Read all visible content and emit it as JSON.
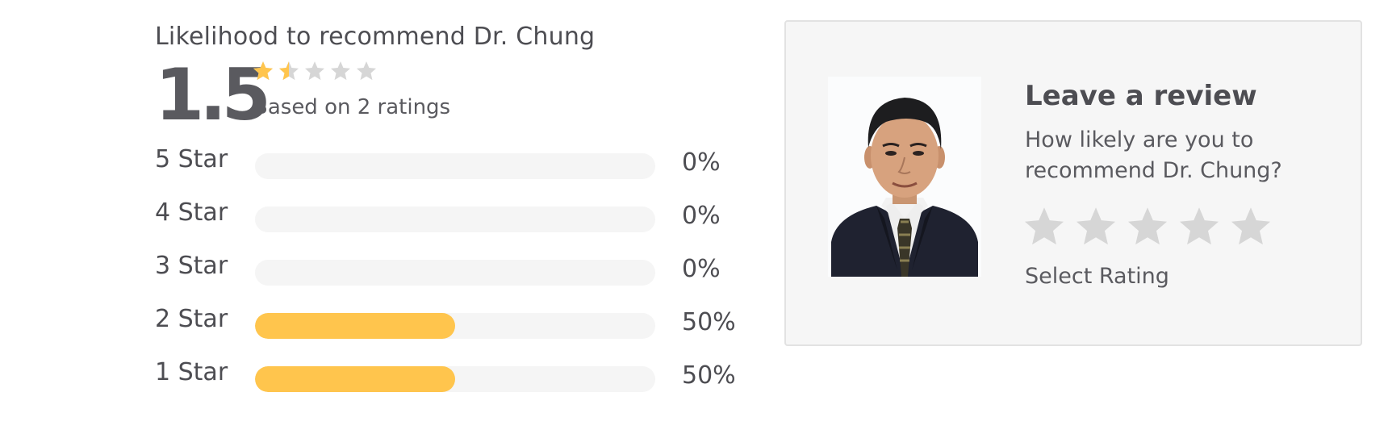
{
  "summary": {
    "title": "Likelihood to recommend Dr. Chung",
    "score": "1.5",
    "star_rating": 1.5,
    "star_max": 5,
    "based_on": "Based on 2 ratings"
  },
  "distribution": [
    {
      "label": "5 Star",
      "percent": 0,
      "percent_label": "0%"
    },
    {
      "label": "4 Star",
      "percent": 0,
      "percent_label": "0%"
    },
    {
      "label": "3 Star",
      "percent": 0,
      "percent_label": "0%"
    },
    {
      "label": "2 Star",
      "percent": 50,
      "percent_label": "50%"
    },
    {
      "label": "1 Star",
      "percent": 50,
      "percent_label": "50%"
    }
  ],
  "review": {
    "title": "Leave a review",
    "question": "How likely are you to recommend Dr. Chung?",
    "select_label": "Select Rating",
    "star_count": 5
  },
  "colors": {
    "star_filled": "#ffc54d",
    "star_empty": "#d6d6d6",
    "bar_fill": "#ffc54d",
    "bar_track": "#f5f5f5",
    "card_bg": "#f6f6f6"
  }
}
